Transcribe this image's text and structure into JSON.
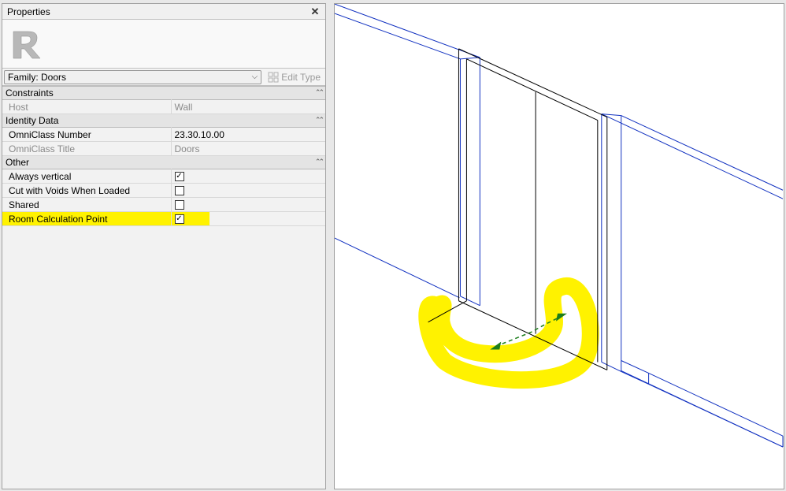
{
  "panel": {
    "title": "Properties",
    "family_label": "Family: Doors",
    "edit_type_label": "Edit Type"
  },
  "groups": {
    "constraints": {
      "title": "Constraints",
      "host_label": "Host",
      "host_value": "Wall"
    },
    "identity": {
      "title": "Identity Data",
      "omniclass_number_label": "OmniClass Number",
      "omniclass_number_value": "23.30.10.00",
      "omniclass_title_label": "OmniClass Title",
      "omniclass_title_value": "Doors"
    },
    "other": {
      "title": "Other",
      "always_vertical_label": "Always vertical",
      "always_vertical_checked": true,
      "cut_voids_label": "Cut with Voids When Loaded",
      "cut_voids_checked": false,
      "shared_label": "Shared",
      "shared_checked": false,
      "room_calc_label": "Room Calculation Point",
      "room_calc_checked": true
    }
  }
}
